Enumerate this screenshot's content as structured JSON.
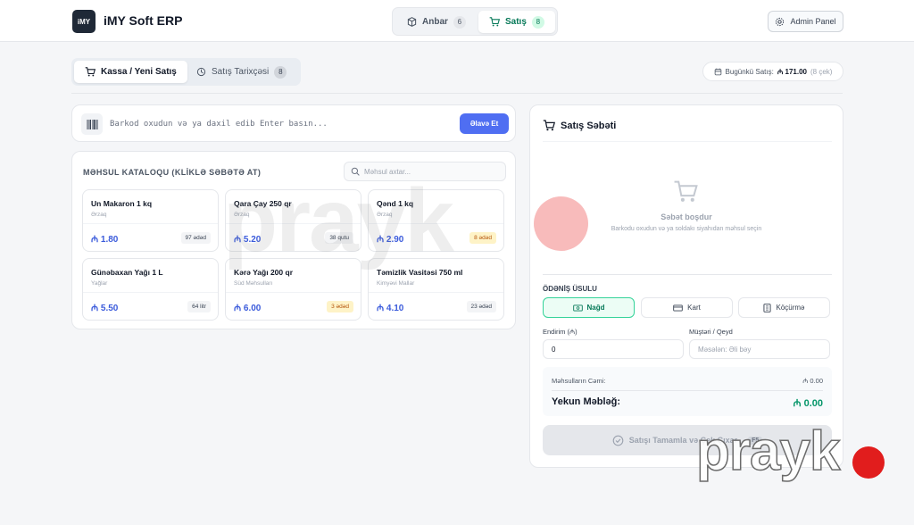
{
  "header": {
    "logo_text": "iMY",
    "app_title": "iMY Soft ERP",
    "tabs": [
      {
        "label": "Anbar",
        "count": "6",
        "icon": "box-icon"
      },
      {
        "label": "Satış",
        "count": "8",
        "icon": "cart-icon"
      }
    ],
    "admin_label": "Admin Panel"
  },
  "subtabs": [
    {
      "label": "Kassa / Yeni Satış"
    },
    {
      "label": "Satış Tarixçəsi",
      "count": "8"
    }
  ],
  "today": {
    "label": "Bugünkü Satış:",
    "value": "₼ 171.00",
    "count": "(8 çek)"
  },
  "barcode": {
    "placeholder": "Barkod oxudun və ya daxil edib Enter basın...",
    "button": "Əlavə Et"
  },
  "catalog": {
    "title": "MƏHSUL KATALOQU (KLİKLƏ SƏBƏTƏ AT)",
    "search_placeholder": "Məhsul axtar...",
    "products": [
      {
        "name": "Un Makaron 1 kq",
        "category": "Ərzaq",
        "price": "₼ 1.80",
        "stock": "97 ədəd",
        "low": false
      },
      {
        "name": "Qara Çay 250 qr",
        "category": "Ərzaq",
        "price": "₼ 5.20",
        "stock": "38 qutu",
        "low": false
      },
      {
        "name": "Qənd 1 kq",
        "category": "Ərzaq",
        "price": "₼ 2.90",
        "stock": "8 ədəd",
        "low": true
      },
      {
        "name": "Günəbaxan Yağı 1 L",
        "category": "Yağlar",
        "price": "₼ 5.50",
        "stock": "64 litr",
        "low": false
      },
      {
        "name": "Kərə Yağı 200 qr",
        "category": "Süd Məhsulları",
        "price": "₼ 6.00",
        "stock": "3 ədəd",
        "low": true
      },
      {
        "name": "Təmizlik Vasitəsi 750 ml",
        "category": "Kimyəvi Mallar",
        "price": "₼ 4.10",
        "stock": "23 ədəd",
        "low": false
      }
    ]
  },
  "cart": {
    "title": "Satış Səbəti",
    "empty_title": "Səbət boşdur",
    "empty_sub": "Barkodu oxudun və ya soldakı siyahıdan məhsul seçin",
    "payment_label": "ÖDƏNİŞ ÜSULU",
    "payment_methods": [
      {
        "label": "Nağd",
        "active": true
      },
      {
        "label": "Kart",
        "active": false
      },
      {
        "label": "Köçürmə",
        "active": false
      }
    ],
    "discount_label": "Endirim (₼)",
    "discount_value": "0",
    "customer_label": "Müştəri / Qeyd",
    "customer_placeholder": "Məsələn: Əli bəy",
    "subtotal_label": "Məhsulların Cəmi:",
    "subtotal_value": "₼ 0.00",
    "total_label": "Yekun Məbləğ:",
    "total_value": "₼ 0.00",
    "complete_label": "Satışı Tamamla və Çek Çıxar",
    "complete_key": "F5"
  },
  "watermark": "prayk",
  "colors": {
    "accent": "#4f6ef2",
    "success": "#059669",
    "price": "#3b5bdb"
  }
}
